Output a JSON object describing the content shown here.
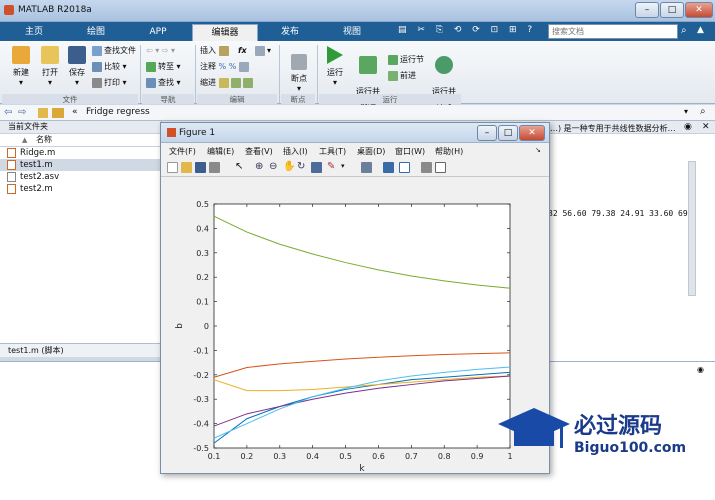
{
  "app": {
    "title": "MATLAB R2018a"
  },
  "tabs": [
    "主页",
    "绘图",
    "APP",
    "编辑器",
    "发布",
    "视图"
  ],
  "search": {
    "placeholder": "搜索文档"
  },
  "ribbon": {
    "file": {
      "new": "新建",
      "open": "打开",
      "save": "保存",
      "find_files": "查找文件",
      "compare": "比较",
      "print": "打印",
      "group": "文件"
    },
    "navigate": {
      "goto": "转至",
      "find": "查找",
      "group": "导航"
    },
    "edit": {
      "insert": "插入",
      "comment": "注释",
      "indent": "缩进",
      "fx": "fx",
      "group": "编辑"
    },
    "breakpoints": {
      "label": "断点",
      "group": "断点"
    },
    "run": {
      "run": "运行",
      "run_advance": "运行并\n前进",
      "run_section": "运行节",
      "advance": "前进",
      "run_time": "运行并\n计时",
      "group": "运行"
    }
  },
  "address": {
    "path": "Fridge regress"
  },
  "current_folder": {
    "title": "当前文件夹",
    "column": "名称",
    "column_sort": "▲",
    "files": [
      "Ridge.m",
      "test1.m",
      "test2.asv",
      "test2.m"
    ],
    "status": "test1.m  (脚本)"
  },
  "command_area": {
    "header_text": "…) 是一种专用于共线性数据分析…",
    "data_line": "82 56.60 79.38 24.91 33.60 69"
  },
  "figure": {
    "title": "Figure 1",
    "menu": [
      "文件(F)",
      "编辑(E)",
      "查看(V)",
      "插入(I)",
      "工具(T)",
      "桌面(D)",
      "窗口(W)",
      "帮助(H)"
    ]
  },
  "watermark": {
    "line1": "必过源码",
    "line2": "Biguo100.com"
  },
  "colors": {
    "tabbar": "#1f5f95",
    "series": [
      "#0072bd",
      "#d95319",
      "#edb120",
      "#7e2f8e",
      "#77ac30",
      "#4dbeee"
    ]
  },
  "chart_data": {
    "type": "line",
    "xlabel": "k",
    "ylabel": "b",
    "xlim": [
      0.1,
      1
    ],
    "ylim": [
      -0.5,
      0.5
    ],
    "xticks": [
      "0.1",
      "0.2",
      "0.3",
      "0.4",
      "0.5",
      "0.6",
      "0.7",
      "0.8",
      "0.9",
      "1"
    ],
    "yticks": [
      "0.5",
      "0.4",
      "0.3",
      "0.2",
      "0.1",
      "0",
      "-0.1",
      "-0.2",
      "-0.3",
      "-0.4",
      "-0.5"
    ],
    "x": [
      0.1,
      0.2,
      0.3,
      0.4,
      0.5,
      0.6,
      0.7,
      0.8,
      0.9,
      1.0
    ],
    "series": [
      {
        "values": [
          -0.48,
          -0.38,
          -0.33,
          -0.29,
          -0.26,
          -0.24,
          -0.22,
          -0.21,
          -0.2,
          -0.19
        ],
        "color": "#0072bd"
      },
      {
        "values": [
          -0.21,
          -0.17,
          -0.155,
          -0.145,
          -0.135,
          -0.128,
          -0.122,
          -0.117,
          -0.113,
          -0.11
        ],
        "color": "#d95319"
      },
      {
        "values": [
          -0.22,
          -0.265,
          -0.265,
          -0.26,
          -0.25,
          -0.24,
          -0.23,
          -0.22,
          -0.21,
          -0.205
        ],
        "color": "#edb120"
      },
      {
        "values": [
          -0.41,
          -0.36,
          -0.33,
          -0.3,
          -0.275,
          -0.255,
          -0.24,
          -0.225,
          -0.215,
          -0.205
        ],
        "color": "#7e2f8e"
      },
      {
        "values": [
          0.45,
          0.385,
          0.335,
          0.295,
          0.26,
          0.23,
          0.205,
          0.185,
          0.168,
          0.155
        ],
        "color": "#77ac30"
      },
      {
        "values": [
          -0.46,
          -0.4,
          -0.34,
          -0.29,
          -0.255,
          -0.225,
          -0.205,
          -0.19,
          -0.178,
          -0.168
        ],
        "color": "#4dbeee"
      }
    ]
  }
}
